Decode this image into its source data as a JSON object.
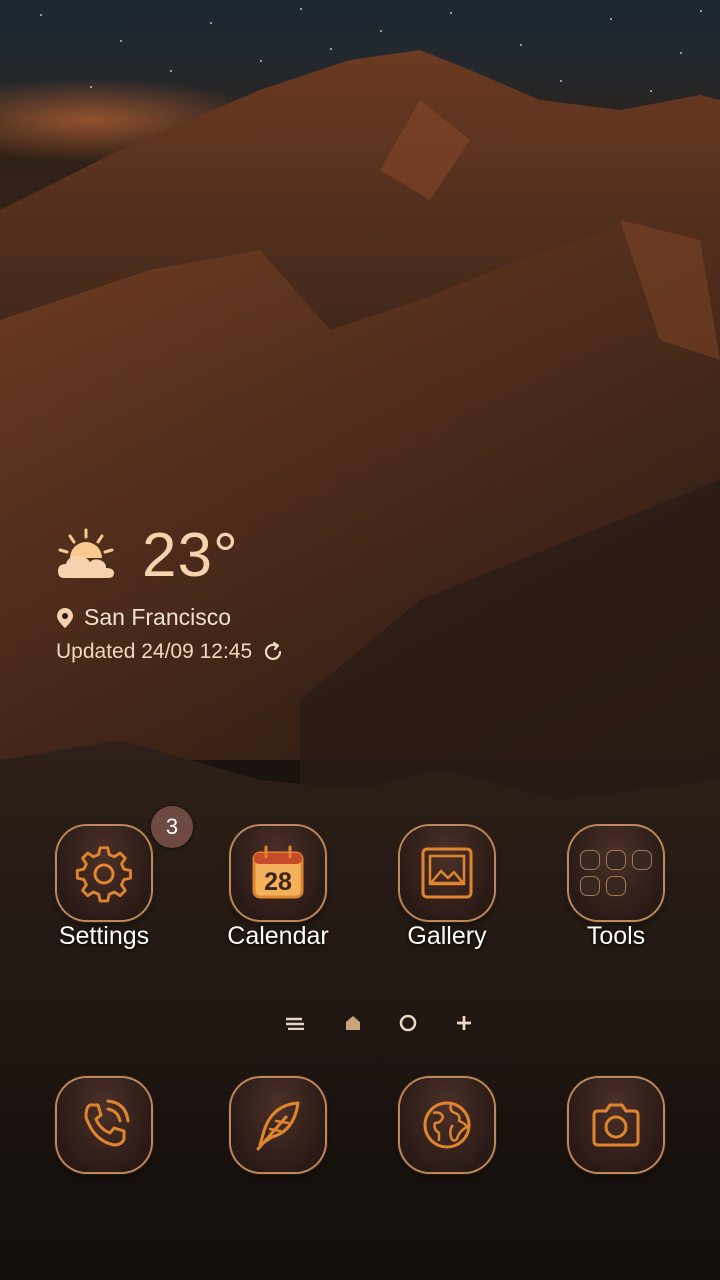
{
  "weather": {
    "icon": "partly-sunny-icon",
    "temperature": "23°",
    "location": "San Francisco",
    "updated": "Updated 24/09 12:45"
  },
  "apps": [
    {
      "label": "Settings",
      "icon": "gear-icon",
      "badge": "3"
    },
    {
      "label": "Calendar",
      "icon": "calendar-icon",
      "date": "28"
    },
    {
      "label": "Gallery",
      "icon": "image-icon"
    },
    {
      "label": "Tools",
      "icon": "folder-icon"
    }
  ],
  "dock": [
    {
      "icon": "phone-icon"
    },
    {
      "icon": "feather-icon"
    },
    {
      "icon": "globe-icon"
    },
    {
      "icon": "camera-icon"
    }
  ],
  "colors": {
    "accent_gold": "#f6d3ae",
    "icon_stroke": "#e0852f",
    "tile_border": "#b8895c"
  }
}
